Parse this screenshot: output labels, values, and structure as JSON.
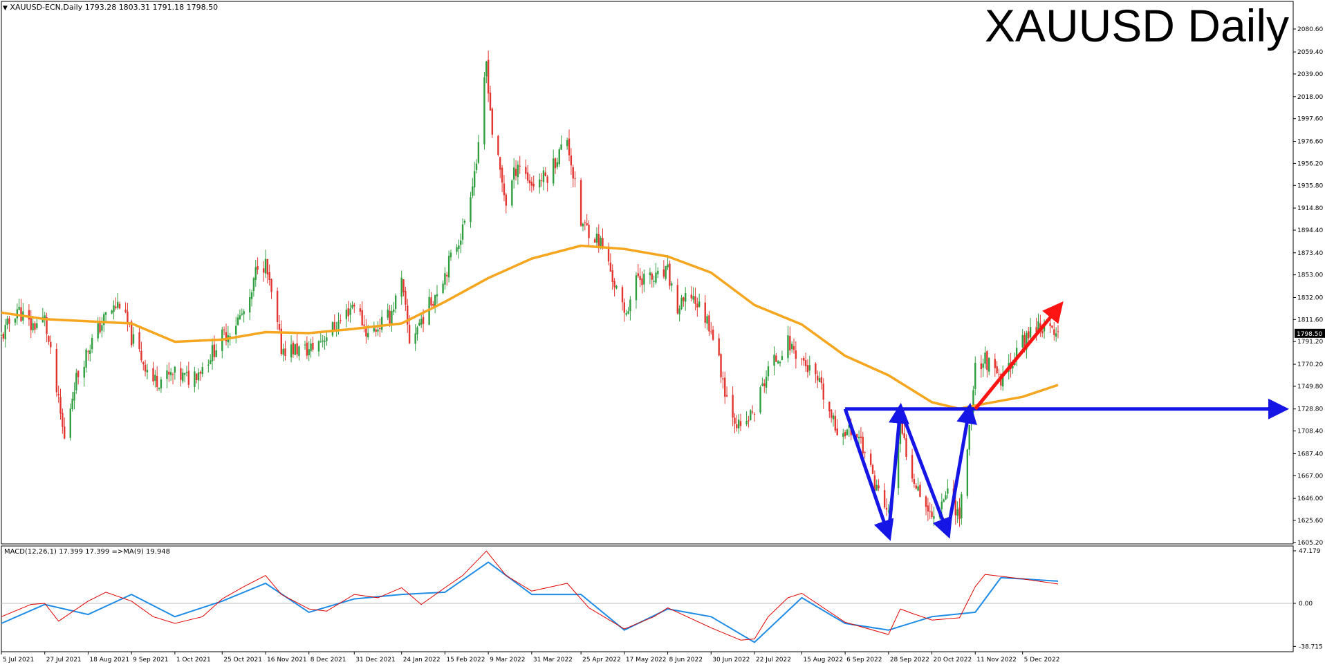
{
  "header": {
    "symbol_line": "XAUUSD-ECN,Daily",
    "ohlc": "1793.28 1803.31 1791.18 1798.50",
    "big_title": "XAUUSD Daily"
  },
  "macd_header": {
    "label": "MACD(12,26,1) 17.399 17.399 =>MA(9) 19.948"
  },
  "colors": {
    "bull": "#2e9e3e",
    "bear": "#e3342f",
    "ma": "#f5a51e",
    "blue_arrows": "#1515e6",
    "red_arrow": "#ff1414",
    "macd_line": "#e00000",
    "signal_line": "#1e8ce6",
    "price_tag_bg": "#000000"
  },
  "chart_data": [
    {
      "type": "candlestick",
      "title": "XAUUSD Daily",
      "y_ticks": [
        "2080.60",
        "2059.40",
        "2039.00",
        "2018.00",
        "1997.60",
        "1976.60",
        "1956.20",
        "1935.80",
        "1914.80",
        "1894.40",
        "1873.40",
        "1853.00",
        "1832.00",
        "1811.60",
        "1791.20",
        "1770.20",
        "1749.80",
        "1728.80",
        "1708.40",
        "1687.40",
        "1667.00",
        "1646.00",
        "1625.60",
        "1605.20"
      ],
      "ylim": [
        1600,
        2085
      ],
      "x_ticks": [
        "5 Jul 2021",
        "27 Jul 2021",
        "18 Aug 2021",
        "9 Sep 2021",
        "1 Oct 2021",
        "25 Oct 2021",
        "16 Nov 2021",
        "8 Dec 2021",
        "31 Dec 2021",
        "24 Jan 2022",
        "15 Feb 2022",
        "9 Mar 2022",
        "31 Mar 2022",
        "25 Apr 2022",
        "17 May 2022",
        "8 Jun 2022",
        "30 Jun 2022",
        "22 Jul 2022",
        "15 Aug 2022",
        "6 Sep 2022",
        "28 Sep 2022",
        "20 Oct 2022",
        "11 Nov 2022",
        "5 Dec 2022"
      ],
      "current_price": "1798.50",
      "close_path": [
        [
          "5 Jul 2021",
          1795
        ],
        [
          "13 Jul 2021",
          1822
        ],
        [
          "20 Jul 2021",
          1805
        ],
        [
          "27 Jul 2021",
          1812
        ],
        [
          "6 Aug 2021",
          1700
        ],
        [
          "11 Aug 2021",
          1752
        ],
        [
          "18 Aug 2021",
          1785
        ],
        [
          "27 Aug 2021",
          1815
        ],
        [
          "3 Sep 2021",
          1827
        ],
        [
          "9 Sep 2021",
          1795
        ],
        [
          "20 Sep 2021",
          1755
        ],
        [
          "1 Oct 2021",
          1760
        ],
        [
          "8 Oct 2021",
          1757
        ],
        [
          "15 Oct 2021",
          1768
        ],
        [
          "25 Oct 2021",
          1795
        ],
        [
          "28 Oct 2021",
          1800
        ],
        [
          "8 Nov 2021",
          1825
        ],
        [
          "12 Nov 2021",
          1865
        ],
        [
          "16 Nov 2021",
          1862
        ],
        [
          "24 Nov 2021",
          1785
        ],
        [
          "8 Dec 2021",
          1783
        ],
        [
          "17 Dec 2021",
          1798
        ],
        [
          "24 Dec 2021",
          1810
        ],
        [
          "31 Dec 2021",
          1828
        ],
        [
          "7 Jan 2022",
          1797
        ],
        [
          "18 Jan 2022",
          1815
        ],
        [
          "24 Jan 2022",
          1845
        ],
        [
          "28 Jan 2022",
          1792
        ],
        [
          "8 Feb 2022",
          1828
        ],
        [
          "15 Feb 2022",
          1855
        ],
        [
          "24 Feb 2022",
          1895
        ],
        [
          "4 Mar 2022",
          1968
        ],
        [
          "8 Mar 2022",
          2050
        ],
        [
          "11 Mar 2022",
          1985
        ],
        [
          "18 Mar 2022",
          1920
        ],
        [
          "24 Mar 2022",
          1958
        ],
        [
          "31 Mar 2022",
          1937
        ],
        [
          "8 Apr 2022",
          1945
        ],
        [
          "18 Apr 2022",
          1980
        ],
        [
          "25 Apr 2022",
          1900
        ],
        [
          "29 Apr 2022",
          1895
        ],
        [
          "6 May 2022",
          1880
        ],
        [
          "17 May 2022",
          1815
        ],
        [
          "24 May 2022",
          1852
        ],
        [
          "1 Jun 2022",
          1848
        ],
        [
          "8 Jun 2022",
          1855
        ],
        [
          "13 Jun 2022",
          1820
        ],
        [
          "20 Jun 2022",
          1835
        ],
        [
          "30 Jun 2022",
          1805
        ],
        [
          "8 Jul 2022",
          1740
        ],
        [
          "15 Jul 2022",
          1708
        ],
        [
          "22 Jul 2022",
          1728
        ],
        [
          "29 Jul 2022",
          1765
        ],
        [
          "8 Aug 2022",
          1790
        ],
        [
          "15 Aug 2022",
          1775
        ],
        [
          "24 Aug 2022",
          1750
        ],
        [
          "1 Sep 2022",
          1710
        ],
        [
          "6 Sep 2022",
          1710
        ],
        [
          "13 Sep 2022",
          1705
        ],
        [
          "20 Sep 2022",
          1665
        ],
        [
          "28 Sep 2022",
          1630
        ],
        [
          "4 Oct 2022",
          1710
        ],
        [
          "10 Oct 2022",
          1670
        ],
        [
          "20 Oct 2022",
          1628
        ],
        [
          "28 Oct 2022",
          1655
        ],
        [
          "3 Nov 2022",
          1630
        ],
        [
          "8 Nov 2022",
          1710
        ],
        [
          "11 Nov 2022",
          1768
        ],
        [
          "16 Nov 2022",
          1775
        ],
        [
          "24 Nov 2022",
          1752
        ],
        [
          "1 Dec 2022",
          1780
        ],
        [
          "5 Dec 2022",
          1790
        ],
        [
          "12 Dec 2022",
          1808
        ],
        [
          "19 Dec 2022",
          1800
        ],
        [
          "23 Dec 2022",
          1798.5
        ]
      ],
      "moving_average": [
        [
          "5 Jul 2021",
          1818
        ],
        [
          "27 Jul 2021",
          1812
        ],
        [
          "9 Sep 2021",
          1808
        ],
        [
          "1 Oct 2021",
          1791
        ],
        [
          "25 Oct 2021",
          1793
        ],
        [
          "16 Nov 2021",
          1800
        ],
        [
          "8 Dec 2021",
          1799
        ],
        [
          "31 Dec 2021",
          1803
        ],
        [
          "24 Jan 2022",
          1808
        ],
        [
          "15 Feb 2022",
          1828
        ],
        [
          "9 Mar 2022",
          1850
        ],
        [
          "31 Mar 2022",
          1868
        ],
        [
          "25 Apr 2022",
          1880
        ],
        [
          "17 May 2022",
          1877
        ],
        [
          "8 Jun 2022",
          1870
        ],
        [
          "30 Jun 2022",
          1855
        ],
        [
          "22 Jul 2022",
          1825
        ],
        [
          "15 Aug 2022",
          1807
        ],
        [
          "6 Sep 2022",
          1778
        ],
        [
          "28 Sep 2022",
          1760
        ],
        [
          "20 Oct 2022",
          1735
        ],
        [
          "3 Nov 2022",
          1729
        ],
        [
          "11 Nov 2022",
          1732
        ],
        [
          "5 Dec 2022",
          1740
        ],
        [
          "23 Dec 2022",
          1751
        ]
      ],
      "annotations": {
        "neckline_level": 1728.8,
        "double_bottom": [
          [
            "6 Sep 2022",
            1728.8
          ],
          [
            "28 Sep 2022",
            1612
          ],
          [
            "4 Oct 2022",
            1728.8
          ],
          [
            "28 Oct 2022",
            1614
          ],
          [
            "8 Nov 2022",
            1728.8
          ]
        ],
        "breakout_arrow": [
          [
            "11 Nov 2022",
            1728.8
          ],
          [
            "23 Dec 2022",
            1824
          ]
        ]
      }
    },
    {
      "type": "line",
      "title": "MACD(12,26,1) 17.399 17.399 =>MA(9) 19.948",
      "y_ticks": [
        "47.179",
        "0.00",
        "-38.715"
      ],
      "ylim": [
        -38.715,
        47.179
      ],
      "series": [
        {
          "name": "MACD",
          "points": [
            [
              "5 Jul 2021",
              -12
            ],
            [
              "20 Jul 2021",
              -1
            ],
            [
              "27 Jul 2021",
              0
            ],
            [
              "3 Aug 2021",
              -16
            ],
            [
              "18 Aug 2021",
              2
            ],
            [
              "27 Aug 2021",
              10
            ],
            [
              "9 Sep 2021",
              2
            ],
            [
              "20 Sep 2021",
              -12
            ],
            [
              "1 Oct 2021",
              -18
            ],
            [
              "15 Oct 2021",
              -12
            ],
            [
              "25 Oct 2021",
              4
            ],
            [
              "5 Nov 2021",
              15
            ],
            [
              "16 Nov 2021",
              25
            ],
            [
              "24 Nov 2021",
              8
            ],
            [
              "8 Dec 2021",
              -5
            ],
            [
              "17 Dec 2021",
              -7
            ],
            [
              "31 Dec 2021",
              8
            ],
            [
              "12 Jan 2022",
              5
            ],
            [
              "24 Jan 2022",
              14
            ],
            [
              "3 Feb 2022",
              -1
            ],
            [
              "15 Feb 2022",
              14
            ],
            [
              "24 Feb 2022",
              25
            ],
            [
              "8 Mar 2022",
              47
            ],
            [
              "18 Mar 2022",
              25
            ],
            [
              "31 Mar 2022",
              11
            ],
            [
              "18 Apr 2022",
              18
            ],
            [
              "29 Apr 2022",
              -4
            ],
            [
              "17 May 2022",
              -23
            ],
            [
              "1 Jun 2022",
              -12
            ],
            [
              "8 Jun 2022",
              -4
            ],
            [
              "30 Jun 2022",
              -22
            ],
            [
              "15 Jul 2022",
              -33
            ],
            [
              "22 Jul 2022",
              -32
            ],
            [
              "29 Jul 2022",
              -12
            ],
            [
              "8 Aug 2022",
              5
            ],
            [
              "15 Aug 2022",
              9
            ],
            [
              "6 Sep 2022",
              -17
            ],
            [
              "28 Sep 2022",
              -28
            ],
            [
              "4 Oct 2022",
              -5
            ],
            [
              "10 Oct 2022",
              -9
            ],
            [
              "20 Oct 2022",
              -15
            ],
            [
              "3 Nov 2022",
              -13
            ],
            [
              "11 Nov 2022",
              15
            ],
            [
              "16 Nov 2022",
              26
            ],
            [
              "5 Dec 2022",
              22
            ],
            [
              "23 Dec 2022",
              17.4
            ]
          ]
        },
        {
          "name": "MA(9)",
          "points": [
            [
              "5 Jul 2021",
              -18
            ],
            [
              "27 Jul 2021",
              -1
            ],
            [
              "18 Aug 2021",
              -10
            ],
            [
              "9 Sep 2021",
              8
            ],
            [
              "1 Oct 2021",
              -12
            ],
            [
              "25 Oct 2021",
              2
            ],
            [
              "16 Nov 2021",
              18
            ],
            [
              "8 Dec 2021",
              -8
            ],
            [
              "31 Dec 2021",
              4
            ],
            [
              "24 Jan 2022",
              8
            ],
            [
              "15 Feb 2022",
              10
            ],
            [
              "9 Mar 2022",
              37
            ],
            [
              "31 Mar 2022",
              8
            ],
            [
              "25 Apr 2022",
              8
            ],
            [
              "17 May 2022",
              -24
            ],
            [
              "8 Jun 2022",
              -5
            ],
            [
              "30 Jun 2022",
              -12
            ],
            [
              "22 Jul 2022",
              -35
            ],
            [
              "15 Aug 2022",
              5
            ],
            [
              "6 Sep 2022",
              -18
            ],
            [
              "28 Sep 2022",
              -24
            ],
            [
              "20 Oct 2022",
              -12
            ],
            [
              "11 Nov 2022",
              -8
            ],
            [
              "24 Nov 2022",
              23
            ],
            [
              "5 Dec 2022",
              22
            ],
            [
              "23 Dec 2022",
              19.9
            ]
          ]
        }
      ]
    }
  ]
}
